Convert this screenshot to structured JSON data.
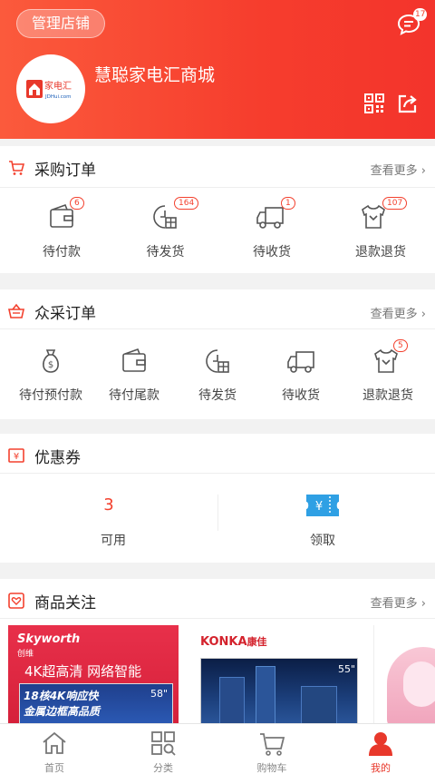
{
  "header": {
    "manage_label": "管理店铺",
    "message_count": "17",
    "store_name": "慧聪家电汇商城",
    "logo_text": "家电汇",
    "logo_sub": "JDHui.com"
  },
  "purchase_orders": {
    "title": "采购订单",
    "more": "查看更多",
    "items": [
      {
        "label": "待付款",
        "badge": "6",
        "icon": "wallet-icon"
      },
      {
        "label": "待发货",
        "badge": "164",
        "icon": "clock-box-icon"
      },
      {
        "label": "待收货",
        "badge": "1",
        "icon": "truck-icon"
      },
      {
        "label": "退款退货",
        "badge": "107",
        "icon": "shirt-return-icon"
      }
    ]
  },
  "group_orders": {
    "title": "众采订单",
    "more": "查看更多",
    "items": [
      {
        "label": "待付预付款",
        "badge": "",
        "icon": "money-bag-icon"
      },
      {
        "label": "待付尾款",
        "badge": "",
        "icon": "wallet-icon"
      },
      {
        "label": "待发货",
        "badge": "",
        "icon": "clock-box-icon"
      },
      {
        "label": "待收货",
        "badge": "",
        "icon": "truck-icon"
      },
      {
        "label": "退款退货",
        "badge": "5",
        "icon": "shirt-return-icon"
      }
    ]
  },
  "coupons": {
    "title": "优惠券",
    "available_count": "3",
    "available_label": "可用",
    "receive_label": "领取"
  },
  "product_follow": {
    "title": "商品关注",
    "more": "查看更多",
    "products": [
      {
        "brand": "Skyworth",
        "brand_cn": "创维",
        "headline": "4K超高清 网络智能",
        "promo": "18核4K响应快",
        "promo2": "金属边框高品质",
        "size": "58\""
      },
      {
        "brand": "KONKA",
        "brand_cn": "康佳",
        "size": "55\""
      }
    ]
  },
  "bottom_nav": [
    {
      "label": "首页",
      "icon": "home-icon"
    },
    {
      "label": "分类",
      "icon": "category-icon"
    },
    {
      "label": "购物车",
      "icon": "cart-icon"
    },
    {
      "label": "我的",
      "icon": "profile-icon"
    }
  ],
  "colors": {
    "accent": "#f3412e",
    "header_start": "#fb5a3c",
    "header_end": "#f3342c"
  }
}
